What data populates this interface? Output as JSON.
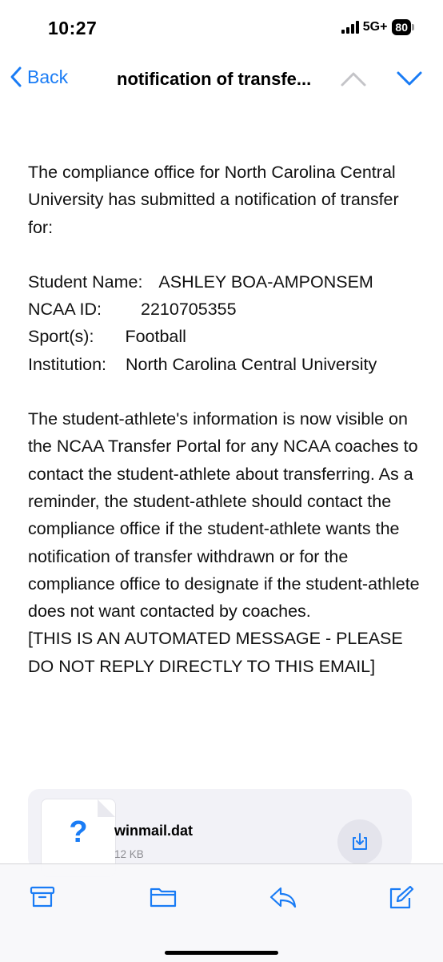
{
  "status": {
    "time": "10:27",
    "network": "5G+",
    "battery": "80"
  },
  "nav": {
    "back_label": "Back",
    "title": "notification of transfe..."
  },
  "email": {
    "intro": "The compliance office for North Carolina Central University has submitted a notification of transfer for:",
    "fields": [
      {
        "label": "Student Name:",
        "value": "ASHLEY BOA-AMPONSEM"
      },
      {
        "label": "NCAA ID:",
        "value": "2210705355"
      },
      {
        "label": "Sport(s):",
        "value": "Football"
      },
      {
        "label": "Institution:",
        "value": "North Carolina Central University"
      }
    ],
    "body": "The student-athlete's information is now visible on the NCAA Transfer Portal for any NCAA coaches to contact the student-athlete about transferring. As a reminder, the student-athlete should contact the compliance office if the student-athlete wants the notification of transfer withdrawn or for the compliance office to designate if the student-athlete does not want contacted by coaches.",
    "automated_note": "[THIS IS AN AUTOMATED MESSAGE - PLEASE DO NOT REPLY DIRECTLY TO THIS EMAIL]"
  },
  "attachment": {
    "icon_glyph": "?",
    "filename": "winmail.dat",
    "size": "12 KB"
  },
  "toolbar": {
    "icons": [
      "archive-icon",
      "folder-icon",
      "reply-icon",
      "compose-icon"
    ]
  },
  "colors": {
    "accent": "#1a7cf5",
    "text": "#111111",
    "secondary": "#8e8e93"
  }
}
